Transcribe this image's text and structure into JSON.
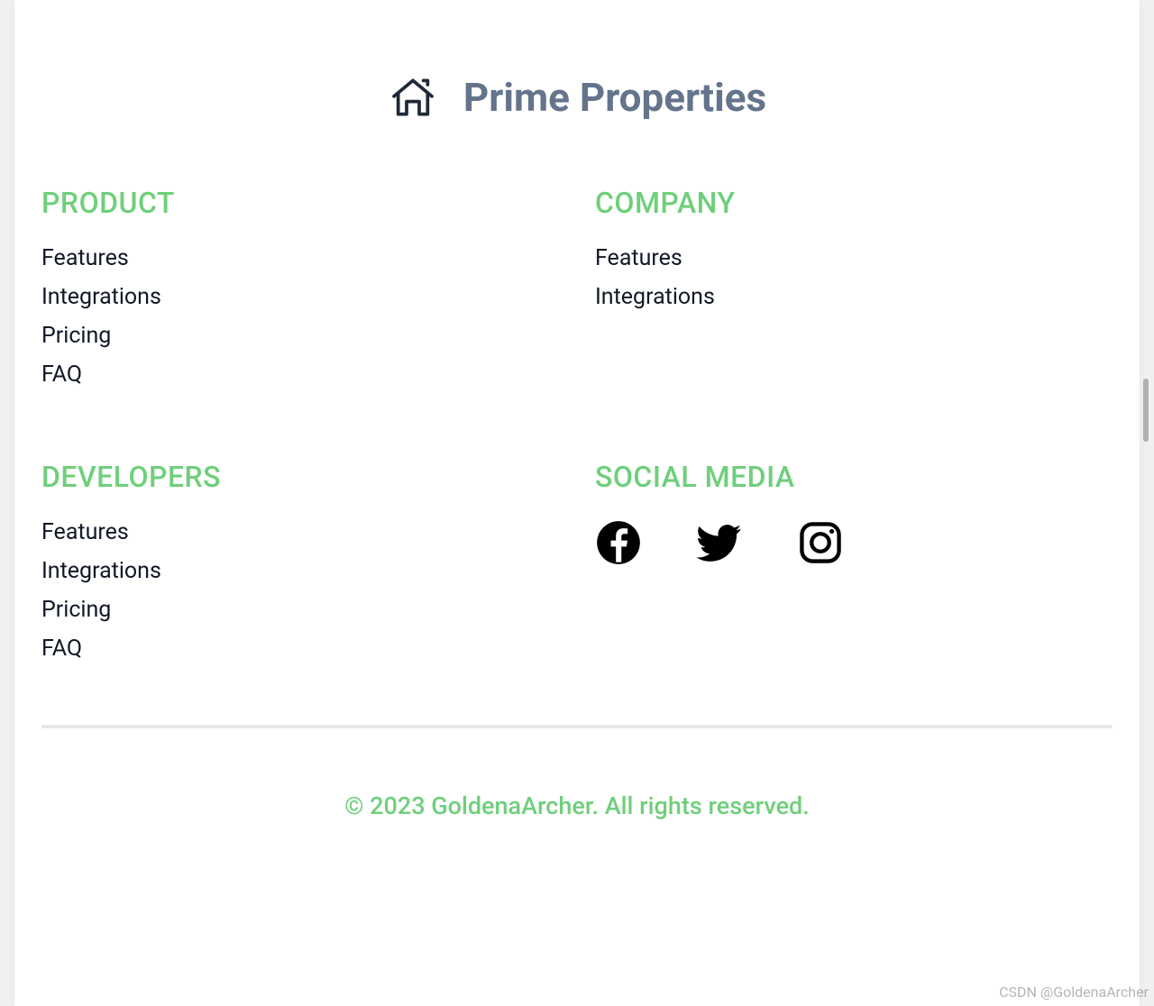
{
  "brand": {
    "name": "Prime Properties"
  },
  "columns": {
    "product": {
      "heading": "PRODUCT",
      "links": [
        "Features",
        "Integrations",
        "Pricing",
        "FAQ"
      ]
    },
    "company": {
      "heading": "COMPANY",
      "links": [
        "Features",
        "Integrations"
      ]
    },
    "developers": {
      "heading": "DEVELOPERS",
      "links": [
        "Features",
        "Integrations",
        "Pricing",
        "FAQ"
      ]
    },
    "social": {
      "heading": "SOCIAL MEDIA",
      "icons": [
        "facebook",
        "twitter",
        "instagram"
      ]
    }
  },
  "copyright": "© 2023 GoldenaArcher. All rights reserved.",
  "watermark": "CSDN @GoldenaArcher"
}
